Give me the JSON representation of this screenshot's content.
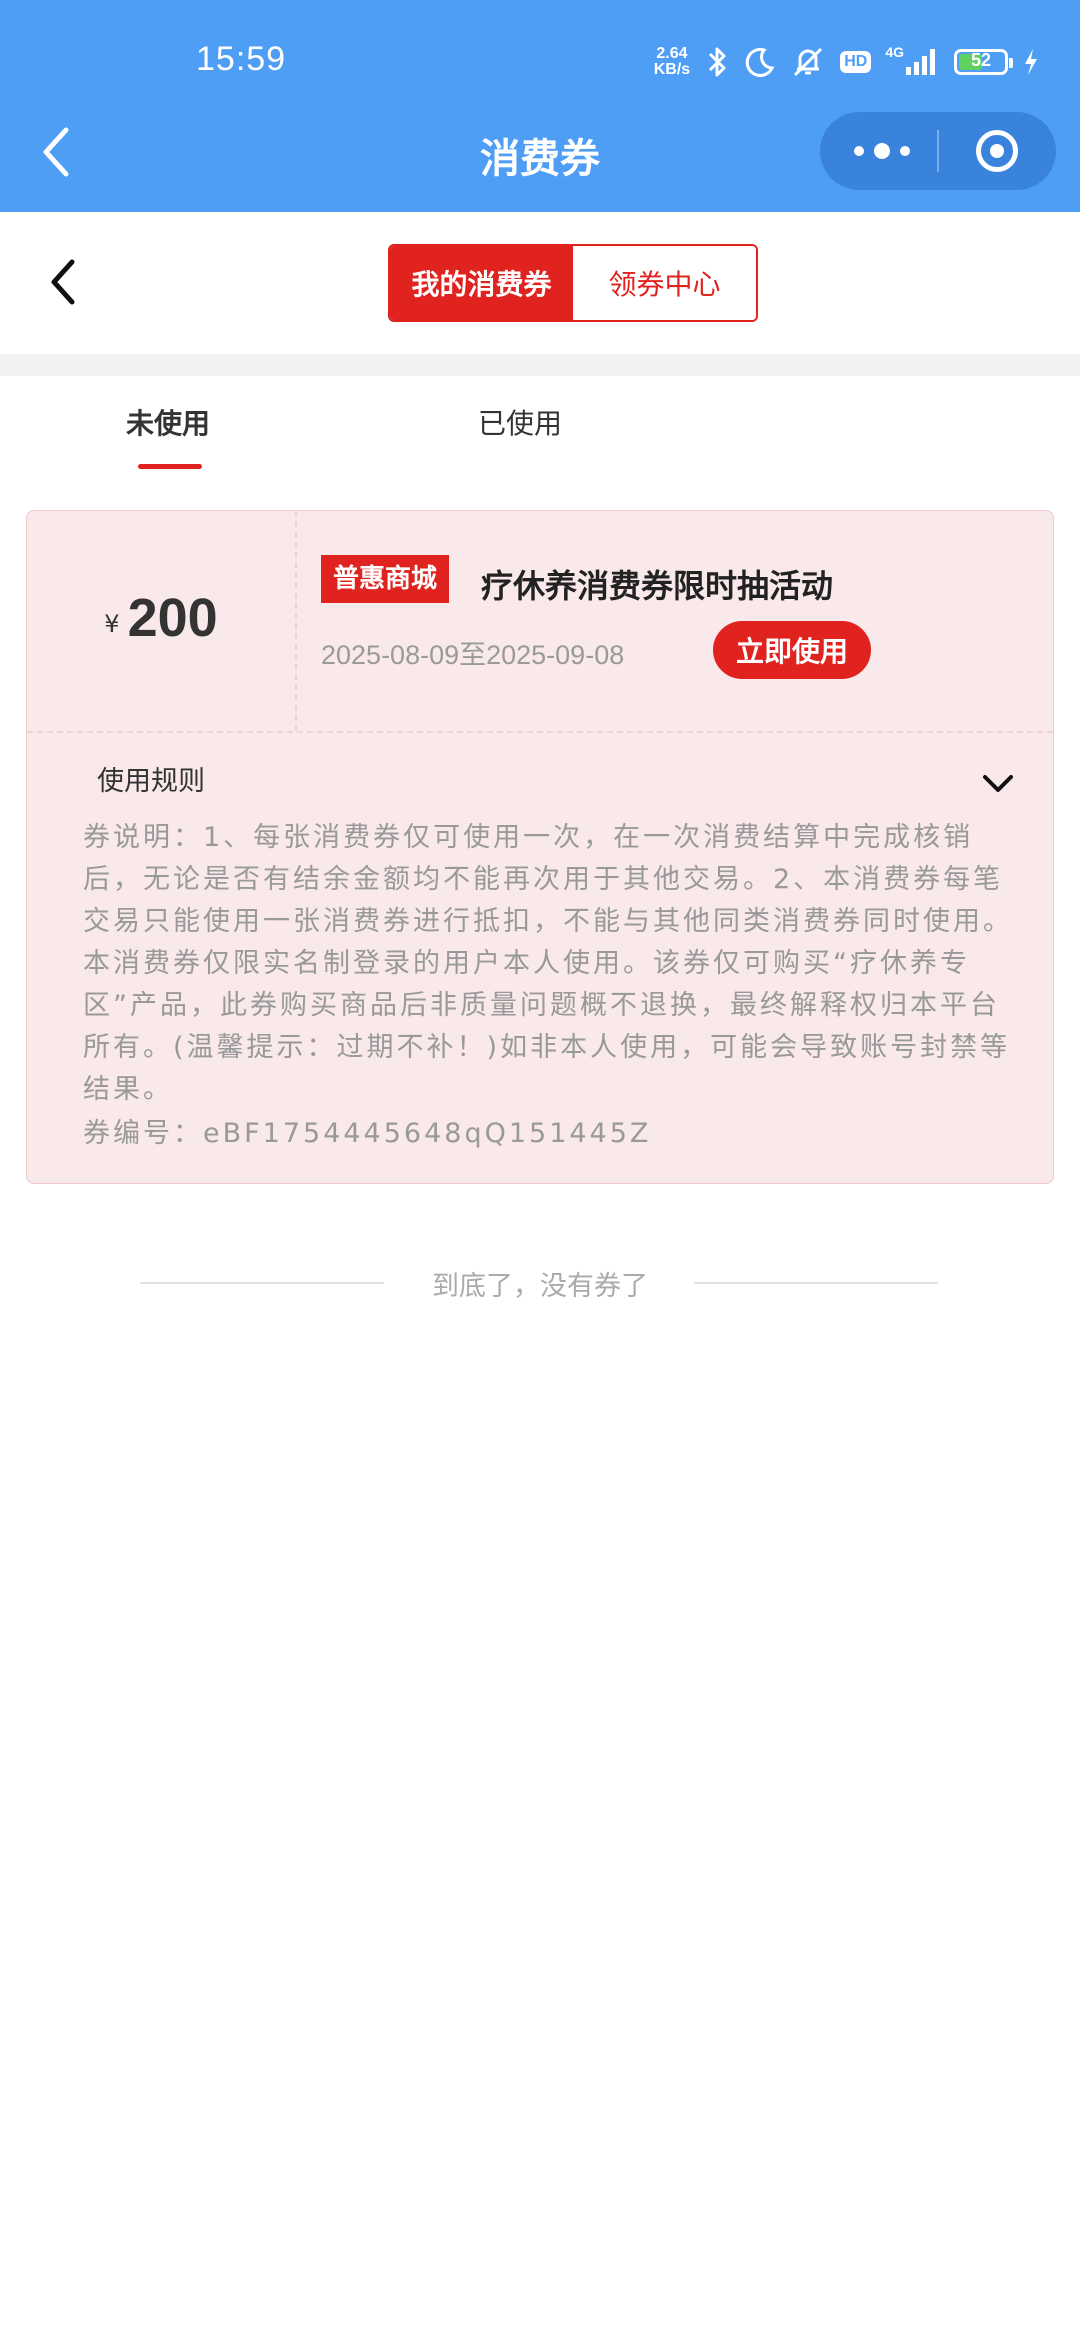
{
  "status_bar": {
    "time": "15:59",
    "net_speed_value": "2.64",
    "net_speed_unit": "KB/s",
    "hd_label": "HD",
    "signal_label": "4G",
    "battery_level": "52",
    "battery_fill_color": "#60d060"
  },
  "nav": {
    "title": "消费券"
  },
  "segment": {
    "my_coupons": "我的消费券",
    "coupon_center": "领券中心"
  },
  "status_tabs": {
    "unused": "未使用",
    "used": "已使用"
  },
  "coupon": {
    "currency": "¥",
    "amount": "200",
    "shop_tag": "普惠商城",
    "title": "疗休养消费券限时抽活动",
    "dates": "2025-08-09至2025-09-08",
    "use_button": "立即使用",
    "rules_heading": "使用规则",
    "rules_text": "券说明：1、每张消费券仅可使用一次，在一次消费结算中完成核销后，无论是否有结余金额均不能再次用于其他交易。2、本消费券每笔交易只能使用一张消费券进行抵扣，不能与其他同类消费券同时使用。本消费券仅限实名制登录的用户本人使用。该券仅可购买“疗休养专区”产品，此券购买商品后非质量问题概不退换，最终解释权归本平台所有。(温馨提示：过期不补！)如非本人使用，可能会导致账号封禁等结果。",
    "code_line": "券编号：eBF1754445648qQ151445Z"
  },
  "list_end": "到底了，没有券了",
  "colors": {
    "brand_blue": "#4f9ef6",
    "accent_red": "#e0231f",
    "card_bg": "#f9e9ea"
  }
}
